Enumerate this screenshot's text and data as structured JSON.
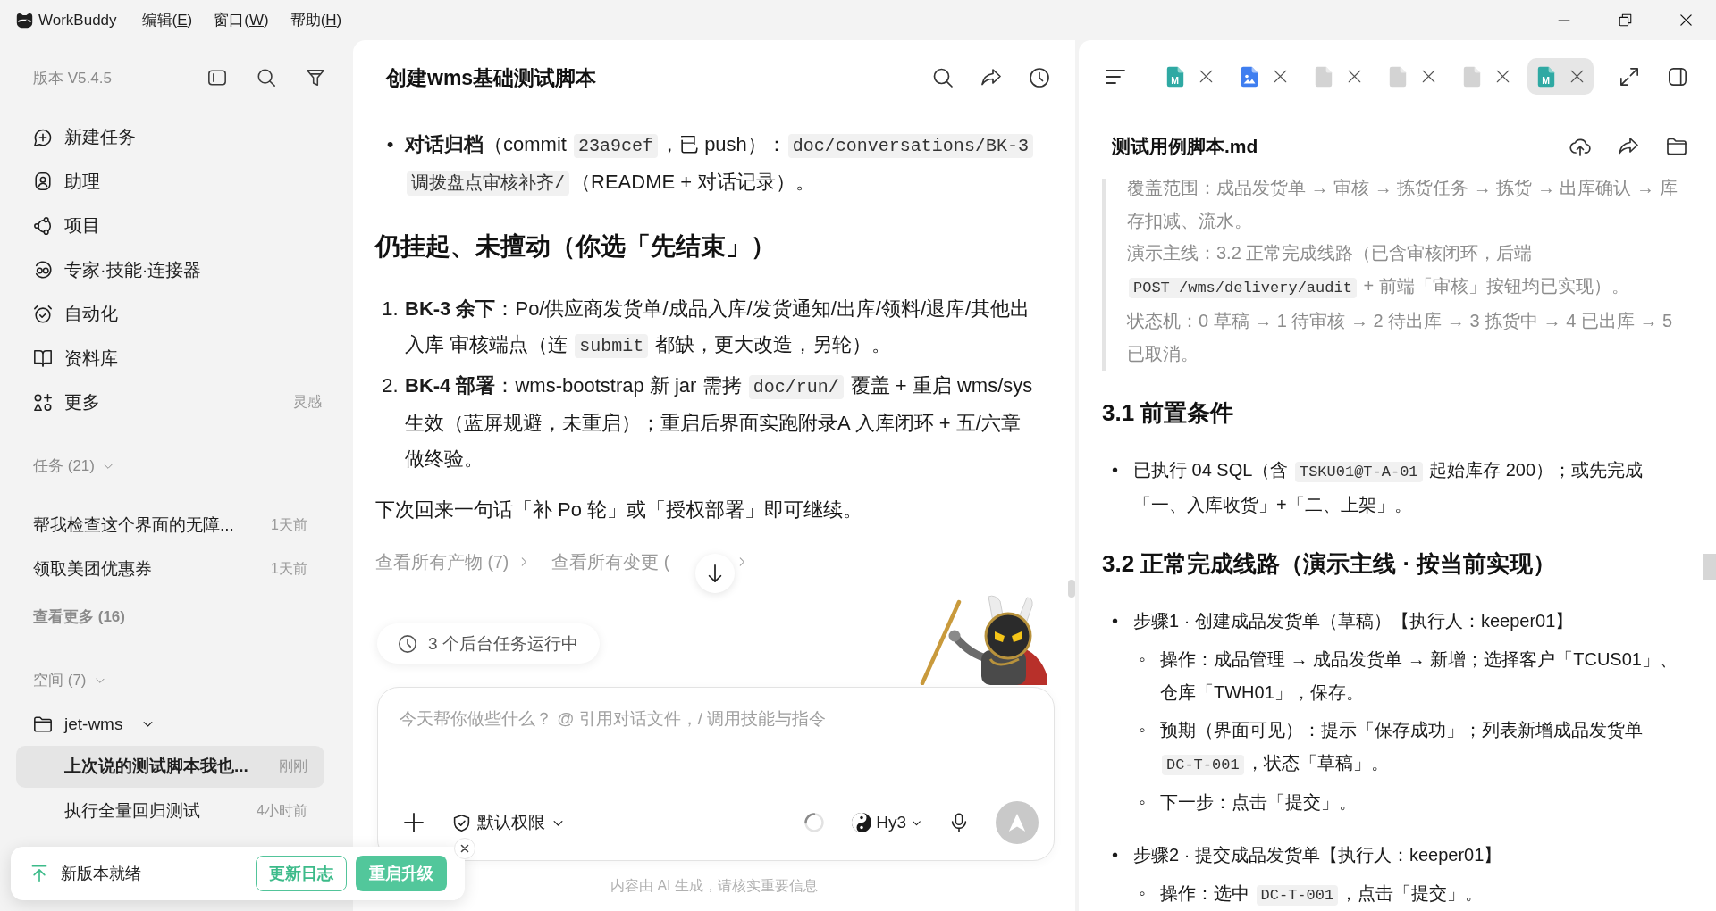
{
  "titlebar": {
    "app_name": "WorkBuddy",
    "menus": [
      {
        "prefix": "编辑(",
        "accelerator": "E",
        "suffix": ")"
      },
      {
        "prefix": "窗口(",
        "accelerator": "W",
        "suffix": ")"
      },
      {
        "prefix": "帮助(",
        "accelerator": "H",
        "suffix": ")"
      }
    ]
  },
  "sidebar": {
    "version": "版本 V5.4.5",
    "nav": [
      {
        "kind": "compose",
        "label": "新建任务"
      },
      {
        "kind": "assistant",
        "label": "助理"
      },
      {
        "kind": "project",
        "label": "项目"
      },
      {
        "kind": "experts",
        "label": "专家·技能·连接器"
      },
      {
        "kind": "automation",
        "label": "自动化"
      },
      {
        "kind": "library",
        "label": "资料库"
      },
      {
        "kind": "more",
        "label": "更多",
        "hint": "灵感"
      }
    ],
    "tasks": {
      "title": "任务 (21)",
      "expanded": true,
      "items": [
        {
          "title": "帮我检查这个界面的无障...",
          "time": "1天前",
          "selected": false
        },
        {
          "title": "领取美团优惠券",
          "time": "1天前",
          "selected": false
        }
      ],
      "more": "查看更多 (16)"
    },
    "spaces": {
      "title": "空间 (7)",
      "expanded": true,
      "folders": [
        {
          "name": "jet-wms",
          "expanded": true,
          "children": [
            {
              "title": "上次说的测试脚本我也...",
              "time": "刚刚",
              "selected": true
            },
            {
              "title": "执行全量回归测试",
              "time": "4小时前",
              "selected": false
            }
          ]
        }
      ]
    }
  },
  "chat": {
    "title": "创建wms基础测试脚本",
    "blocks": [
      {
        "kind": "bullets",
        "items": [
          {
            "marker": "•",
            "runs": [
              {
                "kind": "bold",
                "text": "对话归档"
              },
              {
                "kind": "text",
                "text": "（commit "
              },
              {
                "kind": "code",
                "text": "23a9cef"
              },
              {
                "kind": "text",
                "text": "，已 push）："
              },
              {
                "kind": "code",
                "text": "doc/conversations/BK-3 调拨盘点审核补齐/"
              },
              {
                "kind": "text",
                "text": "（README + 对话记录）。"
              }
            ]
          }
        ]
      },
      {
        "kind": "heading",
        "text": "仍挂起、未擅动（你选「先结束」）"
      },
      {
        "kind": "numbered",
        "items": [
          {
            "marker": "1.",
            "runs": [
              {
                "kind": "bold",
                "text": "BK-3 余下"
              },
              {
                "kind": "text",
                "text": "：Po/供应商发货单/成品入库/发货通知/出库/领料/退库/其他出入库 审核端点（连 "
              },
              {
                "kind": "code",
                "text": "submit"
              },
              {
                "kind": "text",
                "text": " 都缺，更大改造，另轮）。"
              }
            ]
          },
          {
            "marker": "2.",
            "runs": [
              {
                "kind": "bold",
                "text": "BK-4 部署"
              },
              {
                "kind": "text",
                "text": "：wms-bootstrap 新 jar 需拷 "
              },
              {
                "kind": "code",
                "text": "doc/run/"
              },
              {
                "kind": "text",
                "text": " 覆盖 + 重启 wms/sys 生效（蓝屏规避，未重启）；重启后界面实跑附录A 入库闭环 + 五/六章做终验。"
              }
            ]
          }
        ]
      },
      {
        "kind": "paragraph",
        "runs": [
          {
            "kind": "text",
            "text": "下次回来一句话「补 Po 轮」或「授权部署」即可继续。"
          }
        ]
      }
    ],
    "links": [
      {
        "label": "查看所有产物 (7)"
      },
      {
        "label": "查看所有变更 ("
      }
    ],
    "background_tasks": {
      "label": "3 个后台任务运行中"
    },
    "composer": {
      "placeholder": "今天帮你做些什么？ @ 引用对话文件，/ 调用技能与指令",
      "permission": "默认权限",
      "model": "Hy3"
    },
    "disclaimer": "内容由 AI 生成，请核实重要信息"
  },
  "viewer": {
    "tabs": [
      {
        "kind": "markdown",
        "letter": "M",
        "selected": false
      },
      {
        "kind": "image",
        "selected": false
      },
      {
        "kind": "file",
        "selected": false
      },
      {
        "kind": "file",
        "selected": false
      },
      {
        "kind": "file",
        "selected": false
      },
      {
        "kind": "markdown",
        "letter": "M",
        "selected": true
      }
    ],
    "document": {
      "title": "测试用例脚本.md",
      "blocks": [
        {
          "kind": "quote",
          "paragraphs": [
            {
              "runs": [
                {
                  "kind": "text",
                  "text": "覆盖范围：成品发货单 → 审核 → 拣货任务 → 拣货 → 出库确认 → 库存扣减、流水。"
                }
              ]
            },
            {
              "runs": [
                {
                  "kind": "text",
                  "text": "演示主线：3.2 正常完成线路（已含审核闭环，后端 "
                },
                {
                  "kind": "code",
                  "text": "POST /wms/delivery/audit"
                },
                {
                  "kind": "text",
                  "text": " + 前端「审核」按钮均已实现）。"
                }
              ]
            },
            {
              "runs": [
                {
                  "kind": "text",
                  "text": "状态机：0 草稿 → 1 待审核 → 2 待出库 → 3 拣货中 → 4 已出库 → 5 已取消。"
                }
              ]
            }
          ]
        },
        {
          "kind": "heading",
          "text": "3.1 前置条件"
        },
        {
          "kind": "bullets",
          "items": [
            {
              "marker": "•",
              "runs": [
                {
                  "kind": "text",
                  "text": "已执行 04 SQL（含 "
                },
                {
                  "kind": "code",
                  "text": "TSKU01@T-A-01"
                },
                {
                  "kind": "text",
                  "text": " 起始库存 200）；或先完成「一、入库收货」+「二、上架」。"
                }
              ]
            }
          ]
        },
        {
          "kind": "heading",
          "text": "3.2 正常完成线路（演示主线 · 按当前实现）"
        },
        {
          "kind": "bullets",
          "items": [
            {
              "marker": "•",
              "runs": [
                {
                  "kind": "text",
                  "text": "步骤1 · 创建成品发货单（草稿）【执行人：keeper01】"
                }
              ],
              "children": [
                {
                  "marker": "◦",
                  "runs": [
                    {
                      "kind": "text",
                      "text": "操作：成品管理 → 成品发货单 → 新增；选择客户「TCUS01」、仓库「TWH01」，保存。"
                    }
                  ]
                },
                {
                  "marker": "◦",
                  "runs": [
                    {
                      "kind": "text",
                      "text": "预期（界面可见）：提示「保存成功」；列表新增成品发货单 "
                    },
                    {
                      "kind": "code",
                      "text": "DC-T-001"
                    },
                    {
                      "kind": "text",
                      "text": "，状态「草稿」。"
                    }
                  ]
                },
                {
                  "marker": "◦",
                  "runs": [
                    {
                      "kind": "text",
                      "text": "下一步：点击「提交」。"
                    }
                  ]
                }
              ]
            },
            {
              "marker": "•",
              "runs": [
                {
                  "kind": "text",
                  "text": "步骤2 · 提交成品发货单【执行人：keeper01】"
                }
              ],
              "children": [
                {
                  "marker": "◦",
                  "runs": [
                    {
                      "kind": "text",
                      "text": "操作：选中 "
                    },
                    {
                      "kind": "code",
                      "text": "DC-T-001"
                    },
                    {
                      "kind": "text",
                      "text": "，点击「提交」。"
                    }
                  ]
                }
              ]
            }
          ]
        }
      ]
    }
  },
  "update_toast": {
    "message": "新版本就绪",
    "buttons": [
      {
        "kind": "outline",
        "label": "更新日志"
      },
      {
        "kind": "primary",
        "label": "重启升级"
      }
    ]
  }
}
